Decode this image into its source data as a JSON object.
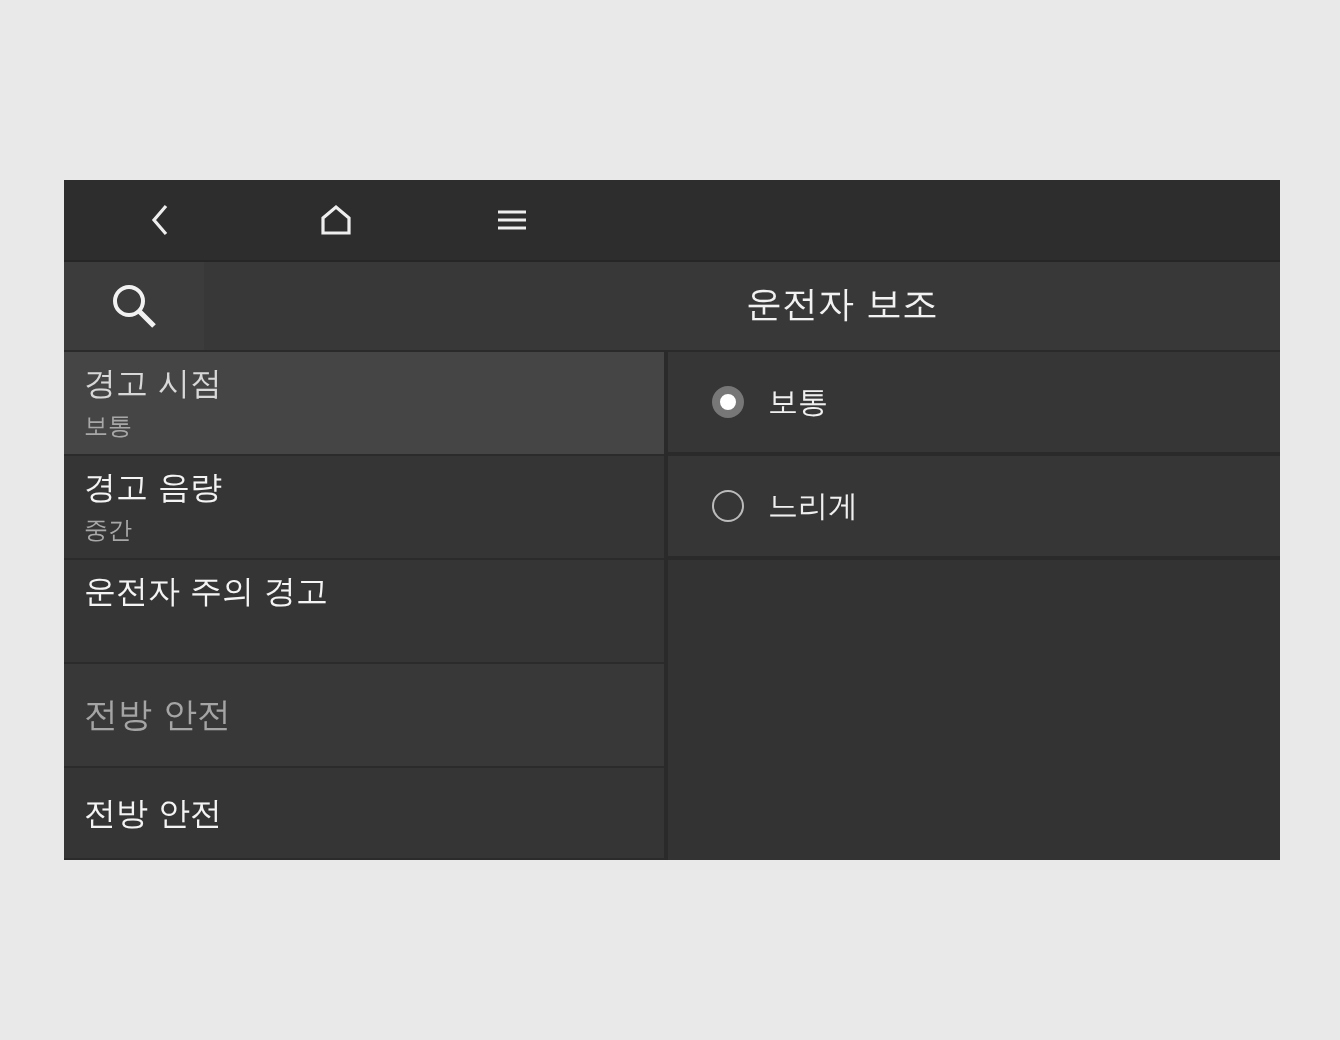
{
  "nav_bar": {
    "buttons": [
      {
        "kind": "back"
      },
      {
        "kind": "home"
      },
      {
        "kind": "menu"
      }
    ]
  },
  "header": {
    "title": "운전자 보조"
  },
  "sidebar": {
    "items": [
      {
        "kind": "setting",
        "label": "경고 시점",
        "value": "보통",
        "selected": true
      },
      {
        "kind": "setting",
        "label": "경고 음량",
        "value": "중간",
        "selected": false
      },
      {
        "kind": "setting",
        "label": "운전자 주의 경고",
        "selected": false
      },
      {
        "kind": "section",
        "label": "전방 안전"
      },
      {
        "kind": "setting",
        "label": "전방 안전",
        "selected": false
      }
    ]
  },
  "options": [
    {
      "label": "보통",
      "selected": true
    },
    {
      "label": "느리게",
      "selected": false
    }
  ]
}
